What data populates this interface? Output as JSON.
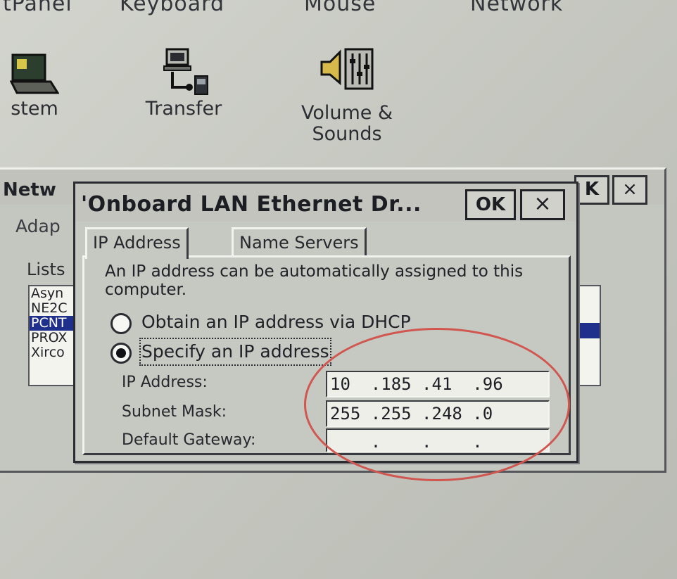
{
  "desktop": {
    "top_labels": [
      "tPanel",
      "Keyboard",
      "Mouse",
      "Network"
    ],
    "icons": [
      {
        "name": "system",
        "label": "stem"
      },
      {
        "name": "transfer",
        "label": "Transfer"
      },
      {
        "name": "volume",
        "label": "Volume &\nSounds"
      }
    ]
  },
  "back_window": {
    "title": "Netw",
    "tab": "Adap",
    "lists_label": "Lists",
    "adapters": [
      "Asyn",
      "NE2C",
      "PCNT",
      "PROX",
      "Xirco"
    ],
    "selected_index": 2,
    "ok_label": "K",
    "close_label": "×"
  },
  "dialog": {
    "title": "'Onboard LAN Ethernet Dr...",
    "ok_label": "OK",
    "close_label": "×",
    "tabs": [
      "IP Address",
      "Name Servers"
    ],
    "active_tab": 0,
    "description": "An IP address can be automatically assigned to this computer.",
    "radio_dhcp": "Obtain an IP address via DHCP",
    "radio_specify": "Specify an IP address",
    "selected_radio": "specify",
    "fields": {
      "ip_label": "IP Address:",
      "ip_value": "10  .185 .41  .96",
      "subnet_label": "Subnet Mask:",
      "subnet_value": "255 .255 .248 .0",
      "gateway_label": "Default Gateway:",
      "gateway_value": "    .    .    ."
    }
  },
  "colors": {
    "selection": "#1f2f8c",
    "annotation_circle": "#d0564f"
  }
}
